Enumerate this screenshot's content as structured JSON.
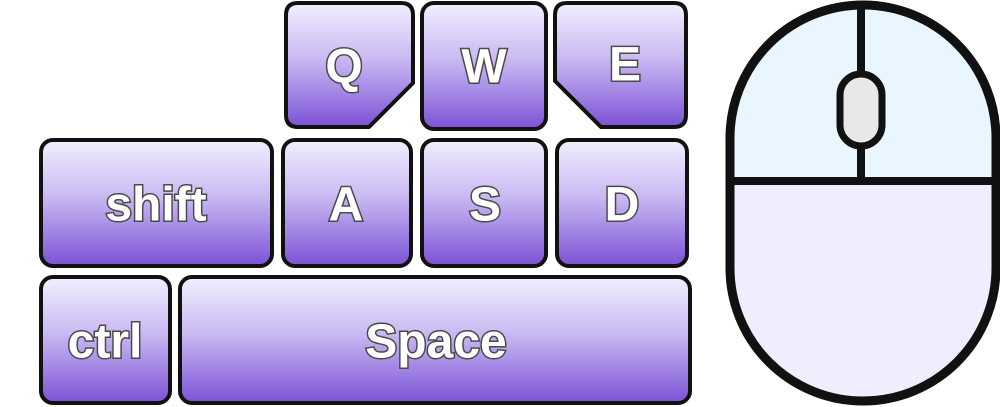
{
  "keyboard": {
    "keys": {
      "q": {
        "label": "Q"
      },
      "w": {
        "label": "W"
      },
      "e": {
        "label": "E"
      },
      "shift": {
        "label": "shift"
      },
      "a": {
        "label": "A"
      },
      "s": {
        "label": "S"
      },
      "d": {
        "label": "D"
      },
      "ctrl": {
        "label": "ctrl"
      },
      "space": {
        "label": "Space"
      }
    }
  },
  "colors": {
    "key_top": "#f2efff",
    "key_bottom": "#7b52d6",
    "outline": "#111111",
    "mouse_top": "#eaf6ff",
    "mouse_bottom": "#efeefe",
    "scroll_wheel": "#e8e8e8"
  },
  "icons": {
    "mouse": "mouse-icon",
    "scroll_wheel": "scroll-wheel-icon"
  }
}
